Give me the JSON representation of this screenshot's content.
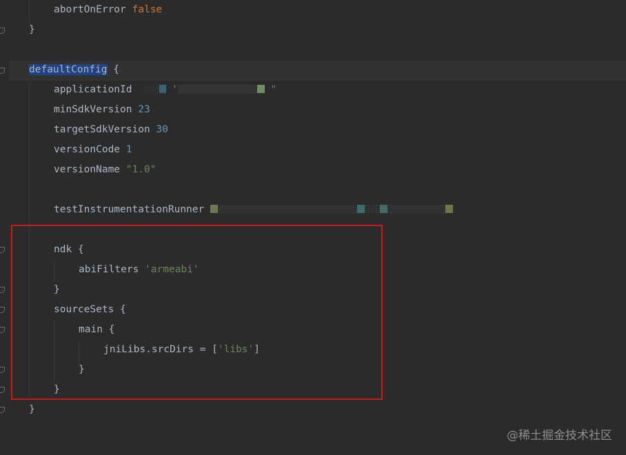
{
  "code": {
    "l1_prop": "abortOnError",
    "l1_val": "false",
    "l2_close": "}",
    "l3_name": "defaultConfig",
    "l3_brace": "{",
    "l4_prop": "applicationId",
    "l5_prop": "minSdkVersion",
    "l5_val": "23",
    "l6_prop": "targetSdkVersion",
    "l6_val": "30",
    "l7_prop": "versionCode",
    "l7_val": "1",
    "l8_prop": "versionName",
    "l8_val": "\"1.0\"",
    "l9_prop": "testInstrumentationRunner",
    "l10_name": "ndk",
    "l10_brace": "{",
    "l11_prop": "abiFilters",
    "l11_val": "'armeabi'",
    "l12_close": "}",
    "l13_name": "sourceSets",
    "l13_brace": "{",
    "l14_name": "main",
    "l14_brace": "{",
    "l15_prop": "jniLibs.srcDirs",
    "l15_eq": "=",
    "l15_open": "[",
    "l15_val": "'libs'",
    "l15_close": "]",
    "l16_close": "}",
    "l17_close": "}",
    "l18_close": "}"
  },
  "watermark": "@稀土掘金技术社区",
  "colors": {
    "background": "#2b2b2b",
    "keyword": "#cc7832",
    "number": "#6897bb",
    "string": "#6a8759",
    "selection": "#214283",
    "highlight_box": "#d0171a"
  }
}
